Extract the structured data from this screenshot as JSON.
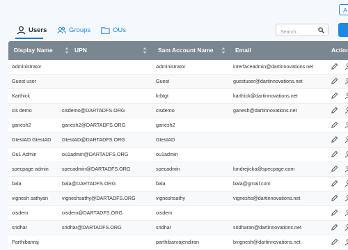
{
  "header": {
    "top_button_label": "A"
  },
  "tabs": [
    {
      "label": "Users",
      "icon": "user-icon",
      "active": true
    },
    {
      "label": "Groups",
      "icon": "groups-icon",
      "active": false
    },
    {
      "label": "OUs",
      "icon": "folder-icon",
      "active": false
    }
  ],
  "search": {
    "placeholder": "Search..."
  },
  "table": {
    "columns": [
      "Display Name",
      "UPN",
      "Sam Account Name",
      "Email",
      "Action"
    ],
    "rows": [
      {
        "display_name": "Administrator",
        "upn": "",
        "sam": "Administrator",
        "email": "interfaceadmin@dartinnovations.net"
      },
      {
        "display_name": "Guest user",
        "upn": "",
        "sam": "Guest",
        "email": "guestuser@dartinnovations.net"
      },
      {
        "display_name": "Karthick",
        "upn": "",
        "sam": "krbtgt",
        "email": "karthick@dartinnovations.net"
      },
      {
        "display_name": "cis demo",
        "upn": "cisdemo@DARTADFS.ORG",
        "sam": "cisdemo",
        "email": "ganesh@dartinnovations.net"
      },
      {
        "display_name": "ganesh2",
        "upn": "ganesh2@DARTADFS.ORG",
        "sam": "ganesh2",
        "email": ""
      },
      {
        "display_name": "GtestAD GtestAD",
        "upn": "GtestAD@DARTADFS.ORG",
        "sam": "GtestAD",
        "email": ""
      },
      {
        "display_name": "Ou1 Admin",
        "upn": "ou1admin@DARTADFS.ORG",
        "sam": "ou1admin",
        "email": ""
      },
      {
        "display_name": "specpage admin",
        "upn": "specadmin@DARTADFS.ORG",
        "sam": "specadmin",
        "email": "londrejicka@specpage.com"
      },
      {
        "display_name": "bala",
        "upn": "bala@DARTADFS.ORG",
        "sam": "bala",
        "email": "bala@gmail.com"
      },
      {
        "display_name": "vignesh sathyan",
        "upn": "vigneshsathy@DARTADFS.ORG",
        "sam": "vigneshsathy",
        "email": "vigneshs@dartinnovations.net"
      },
      {
        "display_name": "oisdem",
        "upn": "oisdem@DARTADFS.ORG",
        "sam": "oisdem",
        "email": ""
      },
      {
        "display_name": "sridhar",
        "upn": "sridhar@DARTADFS.ORG",
        "sam": "sridhar",
        "email": "sridharan@dartinnovations.net"
      },
      {
        "display_name": "Parthibanraj",
        "upn": "",
        "sam": "parthibanrajendiran",
        "email": "bvignesh@dartinnovations.net"
      }
    ]
  },
  "colors": {
    "accent": "#1e88e5",
    "header_bg": "#7b8790",
    "page_bg": "#f5f8fc"
  }
}
